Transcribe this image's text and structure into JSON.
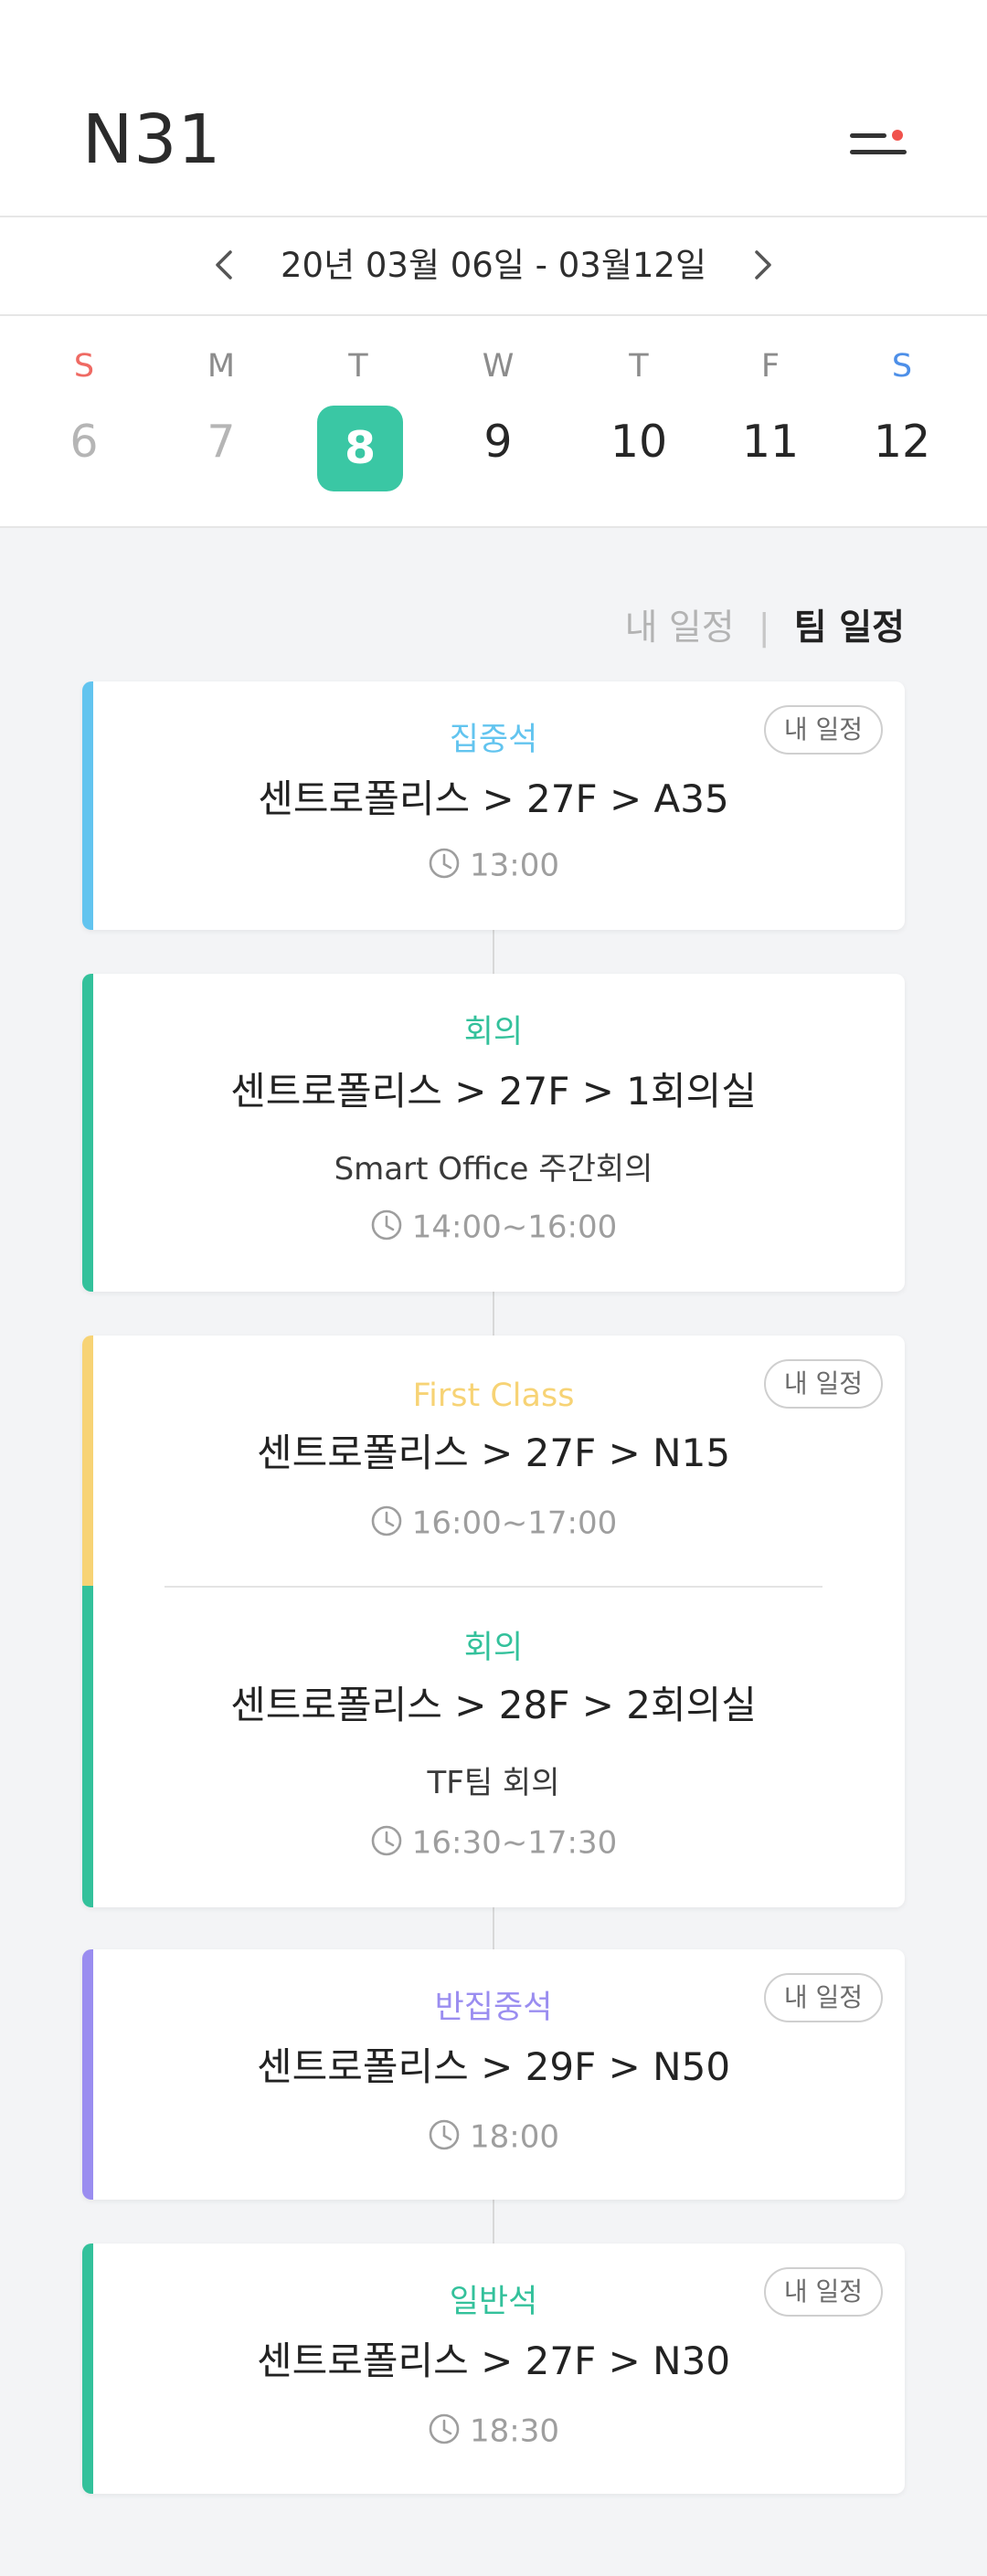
{
  "header": {
    "title": "N31"
  },
  "week_nav": {
    "range": "20년 03월 06일 - 03월12일"
  },
  "days": [
    {
      "dow": "S",
      "num": "6"
    },
    {
      "dow": "M",
      "num": "7"
    },
    {
      "dow": "T",
      "num": "8"
    },
    {
      "dow": "W",
      "num": "9"
    },
    {
      "dow": "T",
      "num": "10"
    },
    {
      "dow": "F",
      "num": "11"
    },
    {
      "dow": "S",
      "num": "12"
    }
  ],
  "selected_day": "8",
  "toggle": {
    "mine": "내 일정",
    "separator": "|",
    "team": "팀 일정"
  },
  "colors": {
    "accent_green": "#3ac7a4",
    "seat_focus": "#62c4ef",
    "meeting": "#33c19b",
    "first_class": "#f7d375",
    "semi_focus": "#9a8df0",
    "general_seat": "#33c19b",
    "sunday": "#ef6a63",
    "saturday": "#4d8fe8",
    "badge_dot": "#f0524c"
  },
  "schedules": [
    {
      "type": "집중석",
      "location": "센트로폴리스 > 27F > A35",
      "time": "13:00",
      "badge": "내 일정"
    },
    {
      "type": "회의",
      "location": "센트로폴리스 > 27F > 1회의실",
      "description": "Smart Office 주간회의",
      "time": "14:00~16:00"
    },
    {
      "type": "First Class",
      "location": "센트로폴리스 > 27F > N15",
      "time": "16:00~17:00",
      "badge": "내 일정"
    },
    {
      "type": "회의",
      "location": "센트로폴리스 > 28F > 2회의실",
      "description": "TF팀 회의",
      "time": "16:30~17:30"
    },
    {
      "type": "반집중석",
      "location": "센트로폴리스 > 29F > N50",
      "time": "18:00",
      "badge": "내 일정"
    },
    {
      "type": "일반석",
      "location": "센트로폴리스 > 27F > N30",
      "time": "18:30",
      "badge": "내 일정"
    }
  ]
}
